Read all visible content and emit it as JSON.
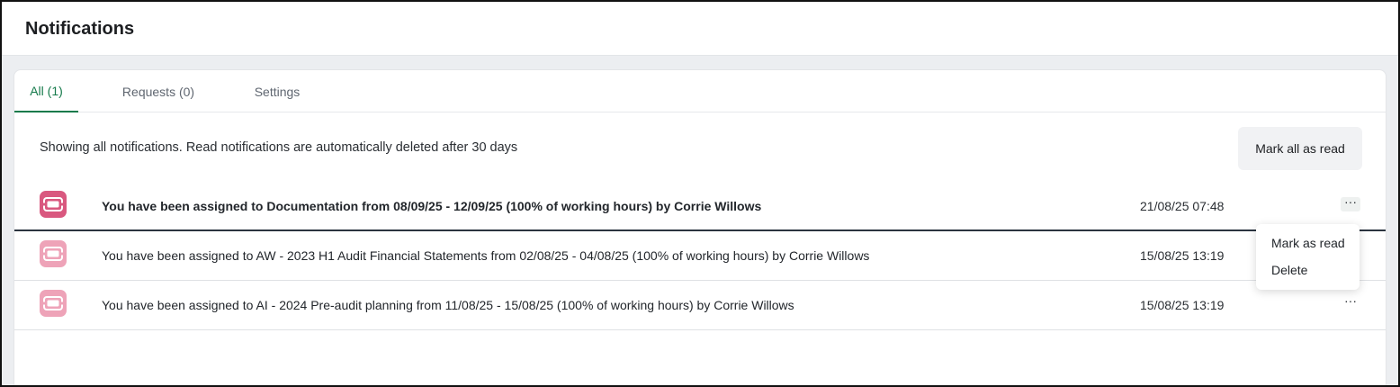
{
  "header": {
    "title": "Notifications"
  },
  "tabs": [
    {
      "label": "All (1)",
      "active": true
    },
    {
      "label": "Requests (0)",
      "active": false
    },
    {
      "label": "Settings",
      "active": false
    }
  ],
  "info": {
    "text": "Showing all notifications. Read notifications are automatically deleted after 30 days",
    "mark_all_label": "Mark all as read"
  },
  "notifications": [
    {
      "text": "You have been assigned to Documentation from 08/09/25 - 12/09/25 (100% of working hours) by Corrie Willows",
      "time": "21/08/25 07:48",
      "unread": true,
      "icon": "calendar-assignment-icon",
      "more_label": "···"
    },
    {
      "text": "You have been assigned to AW - 2023 H1 Audit Financial Statements from 02/08/25 - 04/08/25 (100% of working hours) by Corrie Willows",
      "time": "15/08/25 13:19",
      "unread": false,
      "icon": "calendar-assignment-icon",
      "more_label": "···"
    },
    {
      "text": "You have been assigned to AI - 2024 Pre-audit planning from 11/08/25 - 15/08/25 (100% of working hours) by Corrie Willows",
      "time": "15/08/25 13:19",
      "unread": false,
      "icon": "calendar-assignment-icon",
      "more_label": "···"
    }
  ],
  "context_menu": {
    "items": [
      {
        "label": "Mark as read"
      },
      {
        "label": "Delete"
      }
    ]
  },
  "colors": {
    "accent": "#157a4b",
    "icon_unread": "#d9587f",
    "icon_read": "#eea3b8"
  }
}
